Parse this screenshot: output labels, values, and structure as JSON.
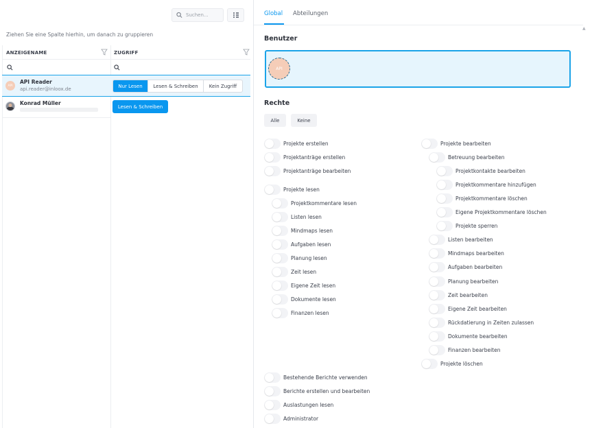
{
  "left": {
    "search": {
      "placeholder": "Suchen..."
    },
    "group_hint": "Ziehen Sie eine Spalte hierhin, um danach zu gruppieren",
    "columns": {
      "name": "ANZEIGENAME",
      "access": "ZUGRIFF"
    },
    "users": [
      {
        "initials": "API",
        "name": "API Reader",
        "email": "api.reader@inloox.de",
        "access_options": [
          "Nur Lesen",
          "Lesen & Schreiben",
          "Kein Zugriff"
        ],
        "access_selected": "Nur Lesen"
      },
      {
        "name": "Konrad Müller",
        "access": "Lesen & Schreiben"
      }
    ]
  },
  "tabs": [
    "Global",
    "Abteilungen"
  ],
  "benutzer": {
    "title": "Benutzer",
    "avatar_initials": "API"
  },
  "rechte": {
    "title": "Rechte",
    "all_label": "Alle",
    "none_label": "Keine",
    "left_column": [
      {
        "label": "Projekte erstellen",
        "level": 0,
        "on": false
      },
      {
        "label": "Projektanträge erstellen",
        "level": 0,
        "on": false
      },
      {
        "label": "Projektanträge bearbeiten",
        "level": 0,
        "on": false
      },
      {
        "label": "Projekte lesen",
        "level": 0,
        "on": false
      },
      {
        "label": "Projektkommentare lesen",
        "level": 1,
        "on": false
      },
      {
        "label": "Listen lesen",
        "level": 1,
        "on": false
      },
      {
        "label": "Mindmaps lesen",
        "level": 1,
        "on": false
      },
      {
        "label": "Aufgaben lesen",
        "level": 1,
        "on": false
      },
      {
        "label": "Planung lesen",
        "level": 1,
        "on": false
      },
      {
        "label": "Zeit lesen",
        "level": 1,
        "on": false
      },
      {
        "label": "Eigene Zeit lesen",
        "level": 1,
        "on": false
      },
      {
        "label": "Dokumente lesen",
        "level": 1,
        "on": false
      },
      {
        "label": "Finanzen lesen",
        "level": 1,
        "on": false
      }
    ],
    "right_column": [
      {
        "label": "Projekte bearbeiten",
        "level": 0,
        "on": false
      },
      {
        "label": "Betreuung bearbeiten",
        "level": 1,
        "on": false
      },
      {
        "label": "Projektkontakte bearbeiten",
        "level": 2,
        "on": false
      },
      {
        "label": "Projektkommentare hinzufügen",
        "level": 2,
        "on": false
      },
      {
        "label": "Projektkommentare löschen",
        "level": 2,
        "on": false
      },
      {
        "label": "Eigene Projektkommentare löschen",
        "level": 2,
        "on": false
      },
      {
        "label": "Projekte sperren",
        "level": 2,
        "on": false
      },
      {
        "label": "Listen bearbeiten",
        "level": 1,
        "on": false
      },
      {
        "label": "Mindmaps bearbeiten",
        "level": 1,
        "on": false
      },
      {
        "label": "Aufgaben bearbeiten",
        "level": 1,
        "on": false
      },
      {
        "label": "Planung bearbeiten",
        "level": 1,
        "on": false
      },
      {
        "label": "Zeit bearbeiten",
        "level": 1,
        "on": false
      },
      {
        "label": "Eigene Zeit bearbeiten",
        "level": 1,
        "on": false
      },
      {
        "label": "Rückdatierung in Zeiten zulassen",
        "level": 1,
        "on": false
      },
      {
        "label": "Dokumente bearbeiten",
        "level": 1,
        "on": false
      },
      {
        "label": "Finanzen bearbeiten",
        "level": 1,
        "on": false
      },
      {
        "label": "Projekte löschen",
        "level": 0,
        "on": false
      }
    ],
    "bottom": [
      {
        "label": "Bestehende Berichte verwenden",
        "on": false
      },
      {
        "label": "Berichte erstellen und bearbeiten",
        "on": false
      },
      {
        "label": "Auslastungen lesen",
        "on": false
      },
      {
        "label": "Administrator",
        "on": false
      }
    ]
  },
  "colors": {
    "accent": "#0a97ef",
    "selection_bg": "#e8f5fd",
    "toggle_off": "#f2f3f6"
  }
}
